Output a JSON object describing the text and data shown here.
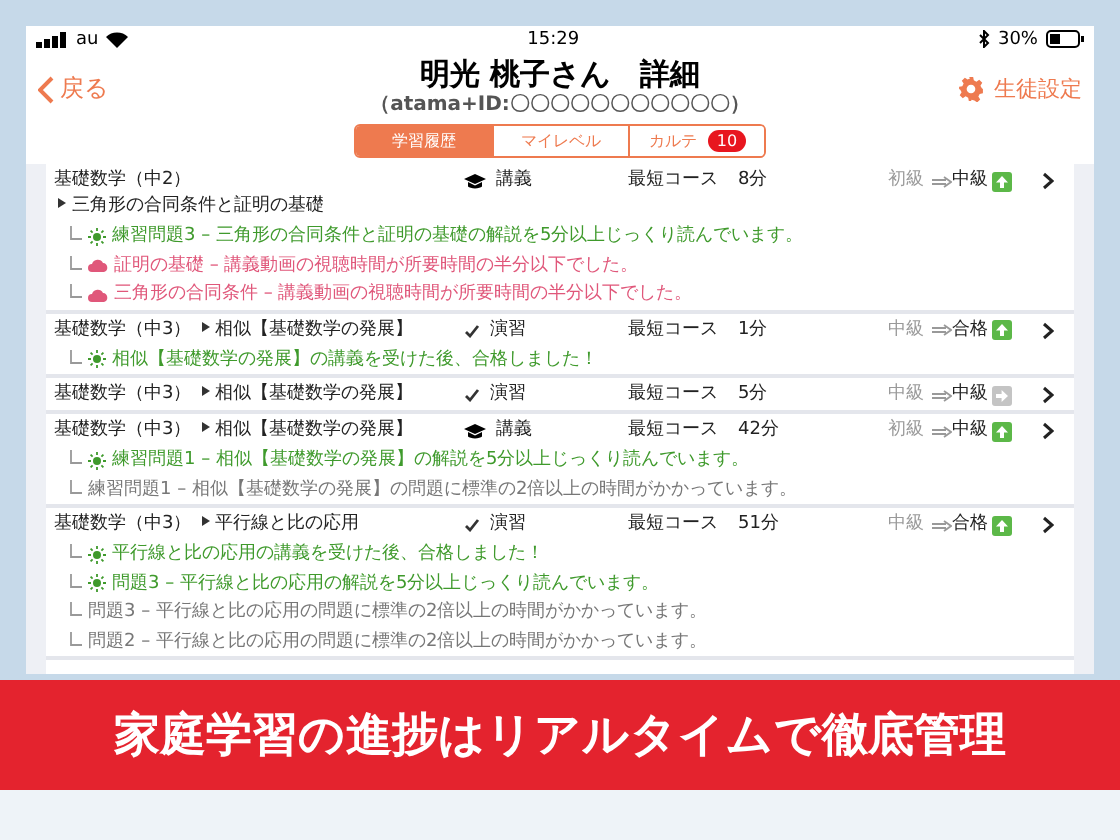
{
  "status_bar": {
    "carrier": "au",
    "time": "15:29",
    "battery": "30%"
  },
  "header": {
    "back": "戻る",
    "title": "明光 桃子さん　詳細",
    "subtitle": "（atama+ID:〇〇〇〇〇〇〇〇〇〇〇）",
    "settings": "生徒設定"
  },
  "tabs": [
    {
      "label": "学習履歴",
      "selected": true
    },
    {
      "label": "マイレベル",
      "selected": false
    },
    {
      "label": "カルテ",
      "selected": false,
      "badge": "10"
    }
  ],
  "rows": [
    {
      "subject": "基礎数学（中2）",
      "unit": "三角形の合同条件と証明の基礎",
      "kind": "lecture",
      "type": "講義",
      "course": "最短コース",
      "time": "8分",
      "level_from": "初級",
      "level_to": "中級",
      "level_up": true,
      "notes": [
        {
          "kind": "good",
          "text": "練習問題3 – 三角形の合同条件と証明の基礎の解説を5分以上じっくり読んでいます。"
        },
        {
          "kind": "bad",
          "text": "証明の基礎 – 講義動画の視聴時間が所要時間の半分以下でした。"
        },
        {
          "kind": "bad",
          "text": "三角形の合同条件 – 講義動画の視聴時間が所要時間の半分以下でした。"
        }
      ]
    },
    {
      "subject": "基礎数学（中3）",
      "unit": "相似【基礎数学の発展】",
      "kind": "exercise",
      "type": "演習",
      "course": "最短コース",
      "time": "1分",
      "level_from": "中級",
      "level_to": "合格",
      "level_up": true,
      "notes": [
        {
          "kind": "good",
          "text": "相似【基礎数学の発展】の講義を受けた後、合格しました！"
        }
      ]
    },
    {
      "subject": "基礎数学（中3）",
      "unit": "相似【基礎数学の発展】",
      "kind": "exercise",
      "type": "演習",
      "course": "最短コース",
      "time": "5分",
      "level_from": "中級",
      "level_to": "中級",
      "level_up": false,
      "notes": []
    },
    {
      "subject": "基礎数学（中3）",
      "unit": "相似【基礎数学の発展】",
      "kind": "lecture",
      "type": "講義",
      "course": "最短コース",
      "time": "42分",
      "level_from": "初級",
      "level_to": "中級",
      "level_up": true,
      "notes": [
        {
          "kind": "good",
          "text": "練習問題1 – 相似【基礎数学の発展】の解説を5分以上じっくり読んでいます。"
        },
        {
          "kind": "neutral",
          "text": "練習問題1 – 相似【基礎数学の発展】の問題に標準の2倍以上の時間がかかっています。"
        }
      ]
    },
    {
      "subject": "基礎数学（中3）",
      "unit": "平行線と比の応用",
      "kind": "exercise",
      "type": "演習",
      "course": "最短コース",
      "time": "51分",
      "level_from": "中級",
      "level_to": "合格",
      "level_up": true,
      "notes": [
        {
          "kind": "good",
          "text": "平行線と比の応用の講義を受けた後、合格しました！"
        },
        {
          "kind": "good",
          "text": "問題3 – 平行線と比の応用の解説を5分以上じっくり読んでいます。"
        },
        {
          "kind": "neutral",
          "text": "問題3 – 平行線と比の応用の問題に標準の2倍以上の時間がかかっています。"
        },
        {
          "kind": "neutral",
          "text": "問題2 – 平行線と比の応用の問題に標準の2倍以上の時間がかかっています。"
        }
      ]
    }
  ],
  "banner": {
    "text": "家庭学習の進捗はリアルタイムで徹底管理"
  }
}
